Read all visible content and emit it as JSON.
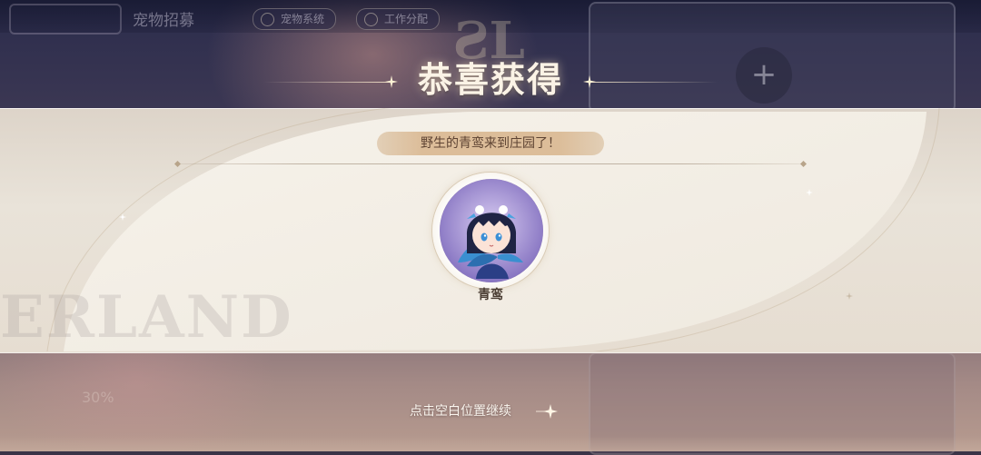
{
  "background": {
    "page_title": "宠物招募",
    "tabs": [
      {
        "label": "宠物系统"
      },
      {
        "label": "工作分配"
      }
    ],
    "watermark_word": "ERLAND",
    "stat_text": "30%"
  },
  "dialog": {
    "title": "恭喜获得",
    "message": "野生的青鸾来到庄园了！",
    "pet": {
      "name": "青鸾",
      "icon": "pet-portrait"
    },
    "continue_hint": "点击空白位置继续"
  },
  "colors": {
    "title": "#fbf3e6",
    "card": "#e9e3d9",
    "pill": "#dcbd99",
    "pill_text": "#5e4433",
    "avatar_bg": "#8a7ac8"
  }
}
